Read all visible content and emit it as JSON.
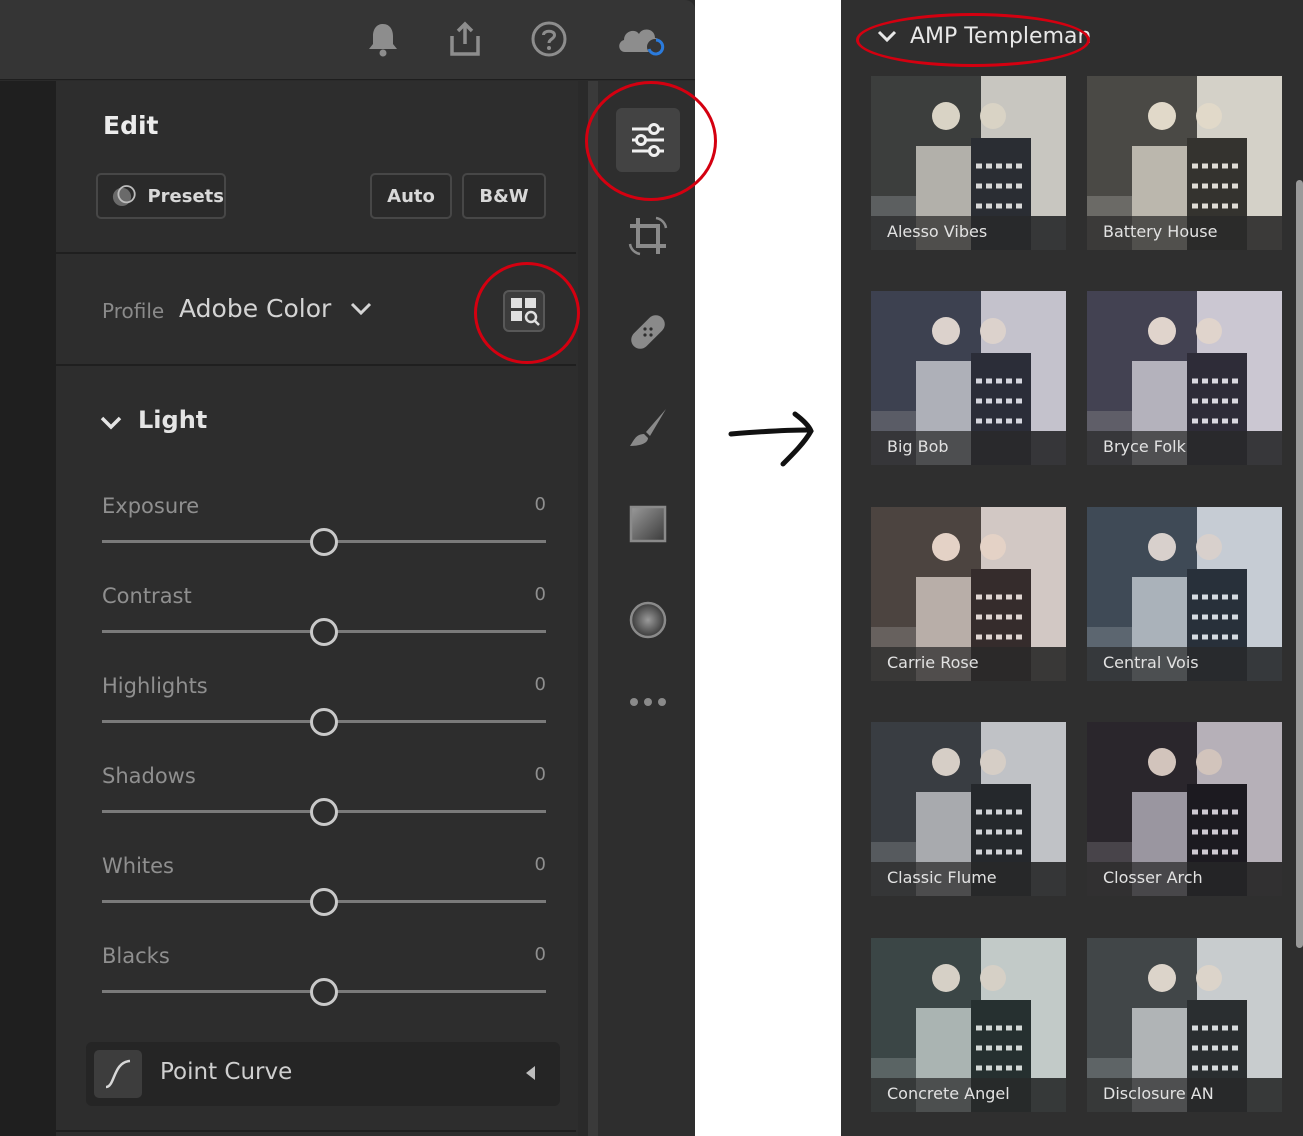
{
  "edit_panel": {
    "title": "Edit",
    "presets_label": "Presets",
    "auto_label": "Auto",
    "bw_label": "B&W",
    "profile_label": "Profile",
    "profile_value": "Adobe Color",
    "section_title": "Light",
    "sliders": [
      {
        "label": "Exposure",
        "value": "0",
        "position": 0.5
      },
      {
        "label": "Contrast",
        "value": "0",
        "position": 0.5
      },
      {
        "label": "Highlights",
        "value": "0",
        "position": 0.5
      },
      {
        "label": "Shadows",
        "value": "0",
        "position": 0.5
      },
      {
        "label": "Whites",
        "value": "0",
        "position": 0.5
      },
      {
        "label": "Blacks",
        "value": "0",
        "position": 0.5
      }
    ],
    "point_curve_label": "Point Curve"
  },
  "top_bar_icons": [
    "bell-icon",
    "share-icon",
    "help-icon",
    "cloud-sync-icon"
  ],
  "tools": [
    "sliders-icon",
    "crop-icon",
    "healing-icon",
    "brush-icon",
    "gradient-icon",
    "radial-icon",
    "more-icon"
  ],
  "profile_browser": {
    "group_title": "AMP Templeman",
    "profiles": [
      "Alesso Vibes",
      "Battery House",
      "Big Bob",
      "Bryce Folk",
      "Carrie Rose",
      "Central Vois",
      "Classic Flume",
      "Closser Arch",
      "Concrete Angel",
      "Disclosure AN"
    ]
  },
  "colors": {
    "annotation_red": "#d40010",
    "panel_bg": "#2d2d2d",
    "cloud_sync_accent": "#2b7bdc"
  }
}
